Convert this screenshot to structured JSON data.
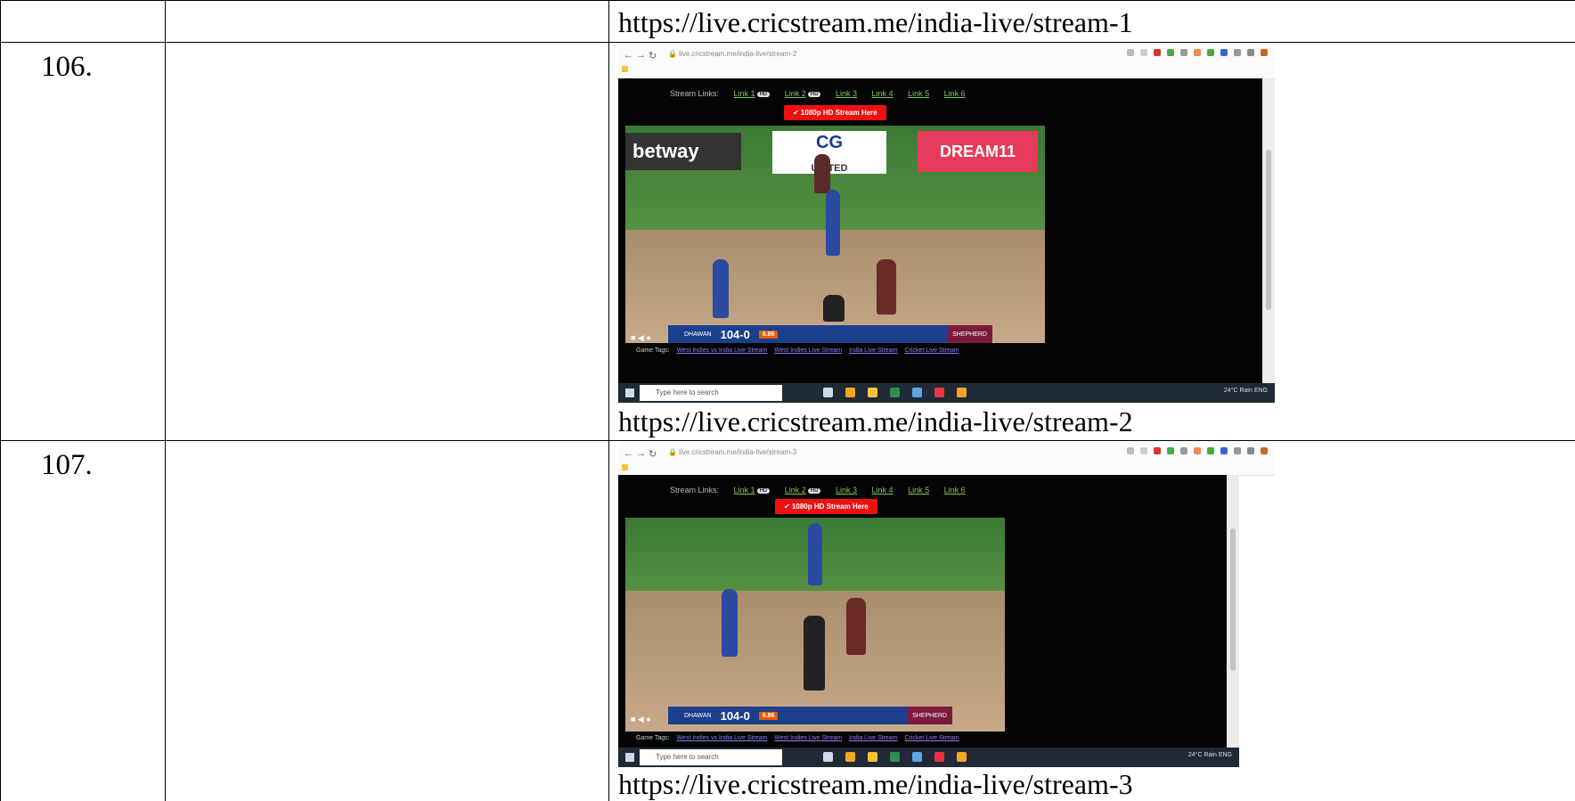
{
  "rows": [
    {
      "number": "106.",
      "url_caption": "https://live.cricstream.me/india-live/stream-2"
    },
    {
      "number": "107.",
      "url_caption": "https://live.cricstream.me/india-live/stream-3"
    }
  ],
  "top_url": "https://live.cricstream.me/india-live/stream-1",
  "screenshot": {
    "stream_links_label": "Stream Links:",
    "links": [
      "Link 1",
      "Link 2",
      "Link 3",
      "Link 4",
      "Link 5",
      "Link 6"
    ],
    "hd_badge": "HD",
    "hd_button": "✔ 1080p HD Stream Here",
    "ads": {
      "left": "betway",
      "center": "CG",
      "center_sub": "UNITED",
      "right": "DREAM11"
    },
    "score": {
      "batter": "DHAWAN",
      "total": "104-0",
      "rate": "6.86",
      "bowler": "SHEPHERD"
    },
    "game_tags_label": "Game Tags:",
    "game_tags": [
      "West Indies vs India Live Stream",
      "West Indies Live Stream",
      "India Live Stream",
      "Cricket Live Stream"
    ],
    "taskbar_search": "Type here to search",
    "tray": "24°C Rain  ENG"
  }
}
